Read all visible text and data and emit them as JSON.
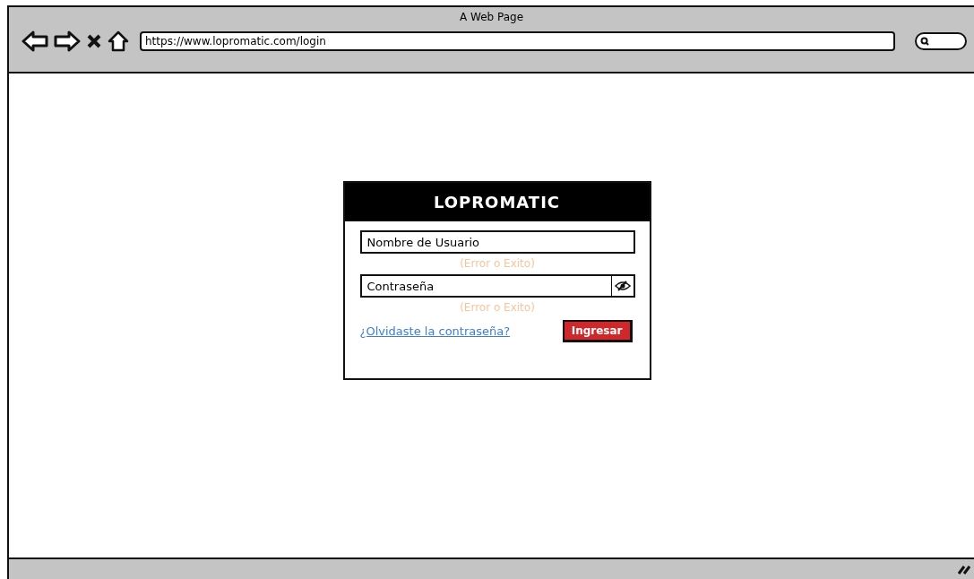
{
  "window": {
    "title": "A Web Page"
  },
  "address_bar": {
    "url": "https://www.lopromatic.com/login"
  },
  "login_card": {
    "title": "LOPROMATIC",
    "fields": [
      {
        "kind": "text",
        "value": "Nombre de Usuario",
        "hint": "(Error o Exito)"
      },
      {
        "kind": "password",
        "value": "Contraseña",
        "hint": "(Error o Exito)"
      }
    ],
    "forgot_link": "¿Olvidaste la contraseña?",
    "submit_button": "Ingresar"
  }
}
